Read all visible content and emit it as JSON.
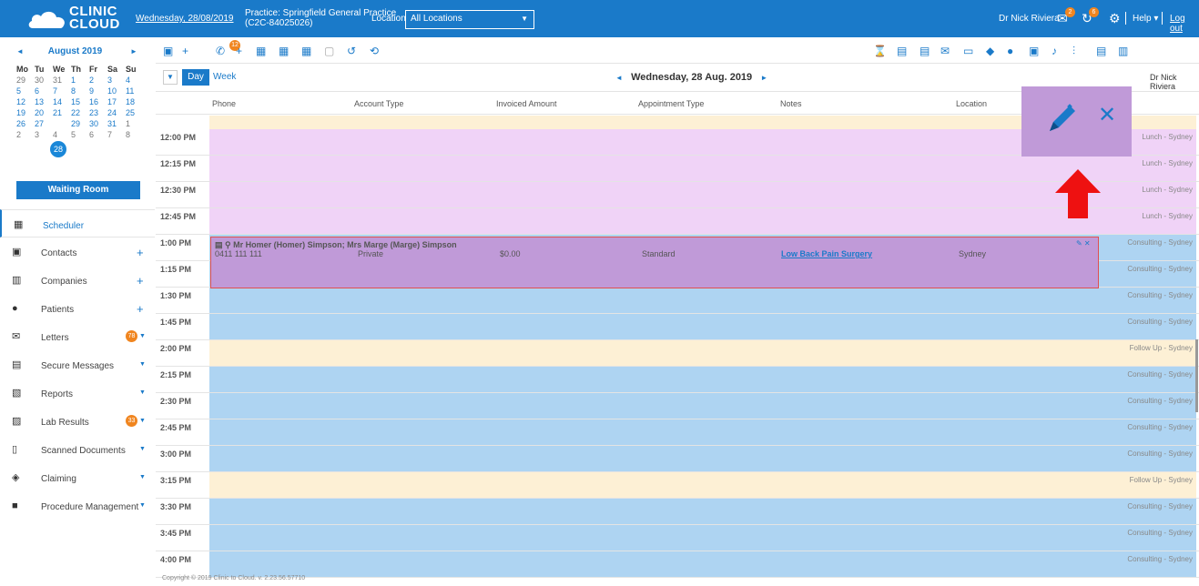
{
  "topbar": {
    "brand_line1": "CLINIC",
    "brand_line2": "CLOUD",
    "date": "Wednesday, 28/08/2019",
    "practice_line1": "Practice: Springfield General Practice",
    "practice_line2": "(C2C-84025026)",
    "location_label": "Location:",
    "location_value": "All Locations",
    "user": "Dr Nick Riviera",
    "badge_messages": "2",
    "badge_recalls": "6",
    "help": "Help",
    "logout": "Log out"
  },
  "calendar": {
    "month": "August 2019",
    "dow": [
      "Mo",
      "Tu",
      "We",
      "Th",
      "Fr",
      "Sa",
      "Su"
    ],
    "weeks": [
      [
        "29",
        "30",
        "31",
        "1",
        "2",
        "3",
        "4"
      ],
      [
        "5",
        "6",
        "7",
        "8",
        "9",
        "10",
        "11"
      ],
      [
        "12",
        "13",
        "14",
        "15",
        "16",
        "17",
        "18"
      ],
      [
        "19",
        "20",
        "21",
        "22",
        "23",
        "24",
        "25"
      ],
      [
        "26",
        "27",
        "28",
        "29",
        "30",
        "31",
        "1"
      ],
      [
        "2",
        "3",
        "4",
        "5",
        "6",
        "7",
        "8"
      ]
    ],
    "selected": "28"
  },
  "sidebar": {
    "waiting_room": "Waiting Room",
    "items": [
      {
        "label": "Scheduler"
      },
      {
        "label": "Contacts"
      },
      {
        "label": "Companies"
      },
      {
        "label": "Patients"
      },
      {
        "label": "Letters",
        "badge": "78"
      },
      {
        "label": "Secure Messages"
      },
      {
        "label": "Reports"
      },
      {
        "label": "Lab Results",
        "badge": "33"
      },
      {
        "label": "Scanned Documents"
      },
      {
        "label": "Claiming"
      },
      {
        "label": "Procedure Management"
      }
    ]
  },
  "toolbar": {
    "phone_badge": "12"
  },
  "scheduler": {
    "view_day": "Day",
    "view_week": "Week",
    "date": "Wednesday, 28 Aug. 2019",
    "practitioner": "Dr Nick Riviera",
    "columns": [
      "Phone",
      "Account Type",
      "Invoiced Amount",
      "Appointment Type",
      "Notes",
      "Location"
    ],
    "slots": [
      {
        "time": "12:00 PM",
        "band": "Lunch - Sydney"
      },
      {
        "time": "12:15 PM",
        "band": "Lunch - Sydney"
      },
      {
        "time": "12:30 PM",
        "band": "Lunch - Sydney"
      },
      {
        "time": "12:45 PM",
        "band": "Lunch - Sydney"
      },
      {
        "time": "1:00 PM",
        "band": "Consulting - Sydney"
      },
      {
        "time": "1:15 PM",
        "band": "Consulting - Sydney"
      },
      {
        "time": "1:30 PM",
        "band": "Consulting - Sydney"
      },
      {
        "time": "1:45 PM",
        "band": "Consulting - Sydney"
      },
      {
        "time": "2:00 PM",
        "band": "Follow Up - Sydney"
      },
      {
        "time": "2:15 PM",
        "band": "Consulting - Sydney"
      },
      {
        "time": "2:30 PM",
        "band": "Consulting - Sydney"
      },
      {
        "time": "2:45 PM",
        "band": "Consulting - Sydney"
      },
      {
        "time": "3:00 PM",
        "band": "Consulting - Sydney"
      },
      {
        "time": "3:15 PM",
        "band": "Follow Up - Sydney"
      },
      {
        "time": "3:30 PM",
        "band": "Consulting - Sydney"
      },
      {
        "time": "3:45 PM",
        "band": "Consulting - Sydney"
      },
      {
        "time": "4:00 PM",
        "band": "Consulting - Sydney"
      }
    ],
    "appointment": {
      "patients": "Mr Homer (Homer) Simpson;  Mrs Marge (Marge) Simpson",
      "phone": "0411 111 111",
      "account_type": "Private",
      "invoiced": "$0.00",
      "appointment_type": "Standard",
      "notes": "Low Back Pain Surgery",
      "location": "Sydney"
    }
  },
  "colors": {
    "brand": "#1a7ac9",
    "lunch": "#f0d3f7",
    "consulting": "#aed4f2",
    "followup": "#fdf0d5",
    "appointment": "#c09ad8",
    "badge": "#f0851f"
  },
  "footer": {
    "copyright": "Copyright © 2019 Clinic to Cloud. v. 2.23.56.57710"
  }
}
